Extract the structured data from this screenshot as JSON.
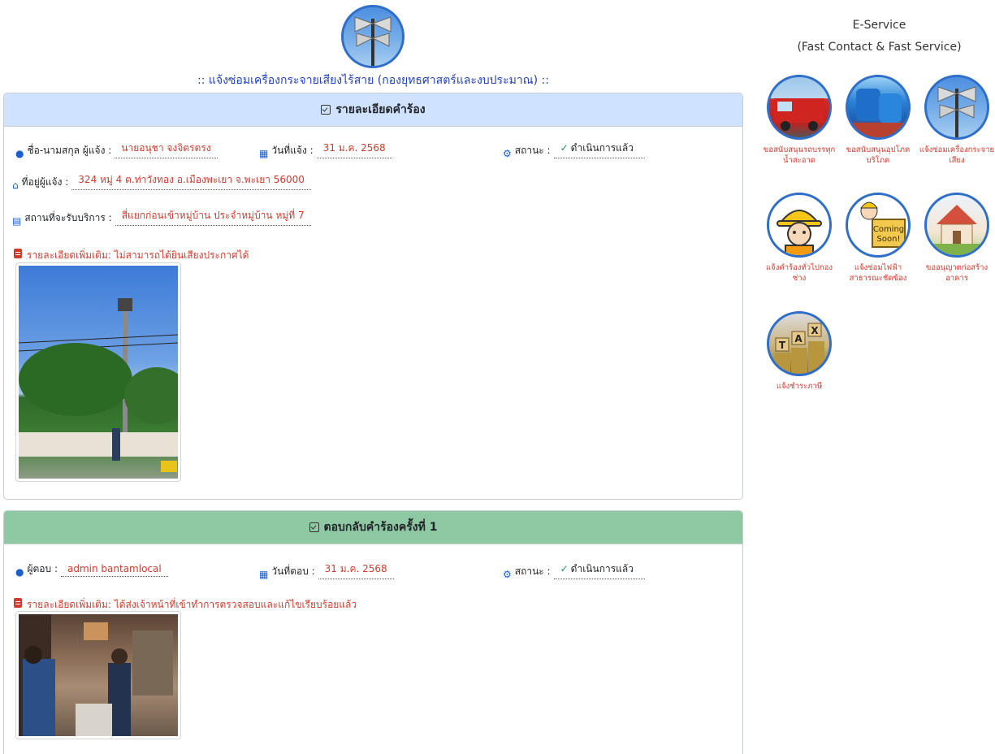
{
  "page": {
    "title": ":: แจ้งซ่อมเครื่องกระจายเสียงไร้สาย (กองยุทธศาสตร์และงบประมาณ) ::"
  },
  "request_card": {
    "header": "รายละเอียดคำร้อง",
    "name_label": "ชื่อ-นามสกุล ผู้แจ้ง :",
    "name_value": "นายอนุชา จงจิตรตรง",
    "date_label": "วันที่แจ้ง :",
    "date_value": "31 ม.ค. 2568",
    "status_label": "สถานะ :",
    "status_value": "ดำเนินการแล้ว",
    "address_label": "ที่อยู่ผู้แจ้ง :",
    "address_value": "324 หมู่ 4 ต.ท่าวังทอง อ.เมืองพะเยา จ.พะเยา 56000",
    "location_label": "สถานที่จะรับบริการ :",
    "location_value": "สี่แยกก่อนเข้าหมู่บ้าน ประจำหมู่บ้าน หมู่ที่ 7",
    "extra": "รายละเอียดเพิ่มเติม: ไม่สามารถได้ยินเสียงประกาศได้"
  },
  "reply_card": {
    "header": "ตอบกลับคำร้องครั้งที่ 1",
    "responder_label": "ผู้ตอบ :",
    "responder_value": "admin bantamlocal",
    "date_label": "วันที่ตอบ :",
    "date_value": "31 ม.ค. 2568",
    "status_label": "สถานะ :",
    "status_value": "ดำเนินการแล้ว",
    "extra": "รายละเอียดเพิ่มเติม: ได้ส่งเจ้าหน้าที่เข้าทำการตรวจสอบและแก้ไขเรียบร้อยแล้ว"
  },
  "sidebar": {
    "title_line1": "E-Service",
    "title_line2": "(Fast Contact & Fast Service)",
    "services": [
      {
        "label": "ขอสนับสนุนรถบรรทุกน้ำสะอาด",
        "icon": "fire-truck-icon"
      },
      {
        "label": "ขอสนับสนุนอุปโภคบริโภค",
        "icon": "water-tank-icon"
      },
      {
        "label": "แจ้งซ่อมเครื่องกระจายเสียง",
        "icon": "loudspeaker-icon"
      },
      {
        "label": "แจ้งคำร้องทั่วไปกองช่าง",
        "icon": "engineer-icon"
      },
      {
        "label": "แจ้งซ่อมไฟฟ้าสาธารณะชัดข้อง",
        "icon": "coming-soon-icon"
      },
      {
        "label": "ขออนุญาตก่อสร้างอาคาร",
        "icon": "house-construction-icon"
      },
      {
        "label": "แจ้งชำระภาษี",
        "icon": "tax-icon"
      }
    ],
    "coming_soon_text": [
      "Coming",
      "Soon!"
    ],
    "tax_letters": [
      "T",
      "A",
      "X"
    ]
  },
  "colors": {
    "link_red": "#d33a2c",
    "title_blue": "#1f3fbf",
    "request_header_bg": "#cfe2ff",
    "reply_header_bg": "#8fc9a3",
    "icon_blue": "#1d5fd0"
  }
}
